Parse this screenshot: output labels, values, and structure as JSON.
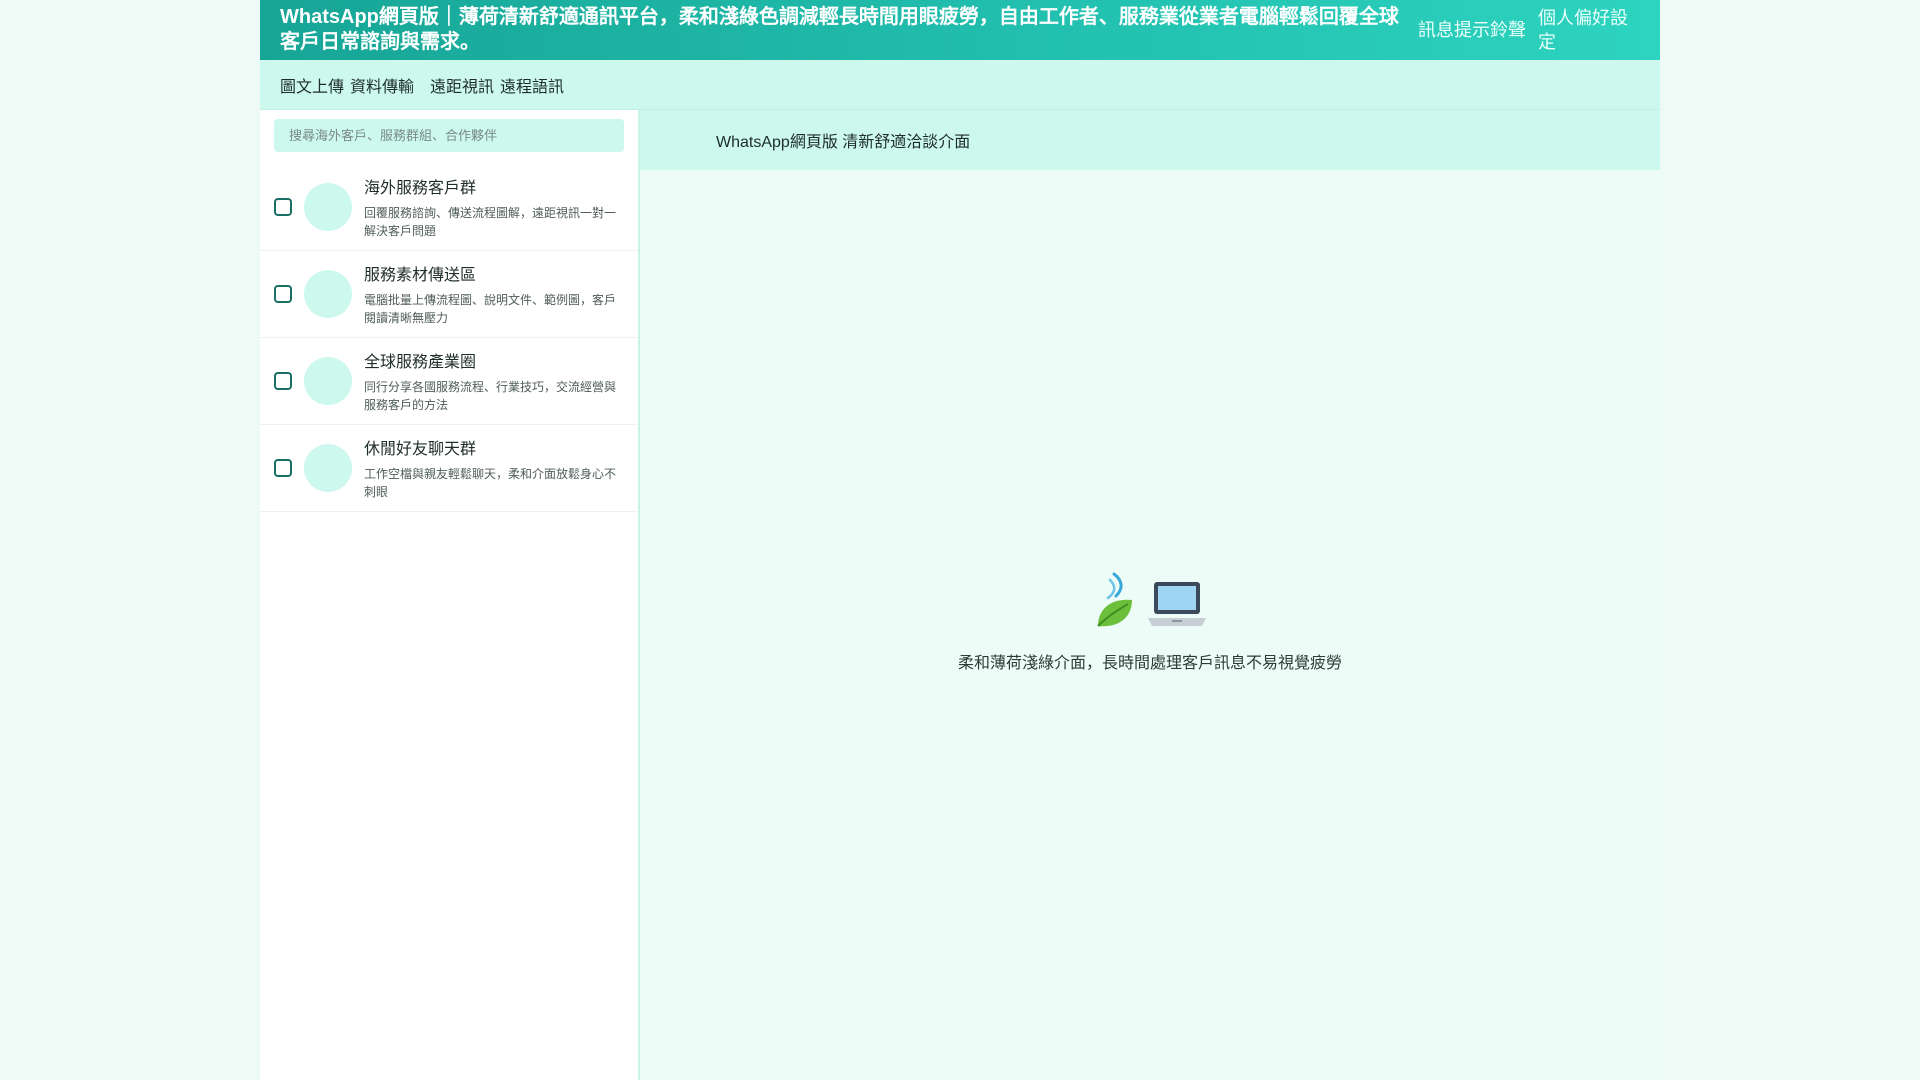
{
  "topbar": {
    "title": "WhatsApp網頁版｜薄荷清新舒適通訊平台，柔和淺綠色調減輕長時間用眼疲勞，自由工作者、服務業從業者電腦輕鬆回覆全球客戶日常諮詢與需求。",
    "action_notifications": "訊息提示鈴聲",
    "action_preferences": "個人偏好設定"
  },
  "toolbar": {
    "items": [
      "圖文上傳",
      "資料傳輸",
      "遠距視訊",
      "遠程語訊"
    ]
  },
  "sidebar": {
    "search_placeholder": "搜尋海外客戶、服務群組、合作夥伴",
    "chats": [
      {
        "name": "海外服務客戶群",
        "desc": "回覆服務諮詢、傳送流程圖解，遠距視訊一對一解決客戶問題"
      },
      {
        "name": "服務素材傳送區",
        "desc": "電腦批量上傳流程圖、說明文件、範例圖，客戶閱讀清晰無壓力"
      },
      {
        "name": "全球服務產業圈",
        "desc": "同行分享各國服務流程、行業技巧，交流經營與服務客戶的方法"
      },
      {
        "name": "休閒好友聊天群",
        "desc": "工作空檔與親友輕鬆聊天，柔和介面放鬆身心不刺眼"
      }
    ]
  },
  "main": {
    "header_title": "WhatsApp網頁版 清新舒適洽談介面",
    "empty_message": "柔和薄荷淺綠介面，長時間處理客戶訊息不易視覺疲勞",
    "empty_icons": [
      "leaf-icon",
      "laptop-icon"
    ]
  },
  "colors": {
    "topbar_start": "#17a596",
    "topbar_end": "#2dd4bf",
    "mint_light": "#ccf8ee",
    "background": "#eefaf6"
  }
}
